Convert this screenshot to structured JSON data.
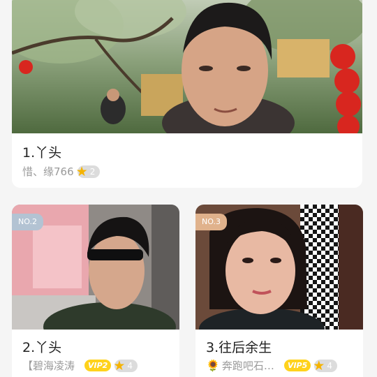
{
  "cards": [
    {
      "name": "1.丫头",
      "meta_text": "惜、缘766",
      "stars": "2"
    },
    {
      "badge": "NO.2",
      "badge_color": "#b3c3d3",
      "name": "2.丫头",
      "meta_text": "【碧海凌涛",
      "vip": "VIP2",
      "stars": "4"
    },
    {
      "badge": "NO.3",
      "badge_color": "#e0b28c",
      "name": "3.往后余生",
      "meta_icon": "sunflower-icon",
      "meta_text": "奔跑吧石…",
      "vip": "VIP5",
      "stars": "4"
    }
  ]
}
